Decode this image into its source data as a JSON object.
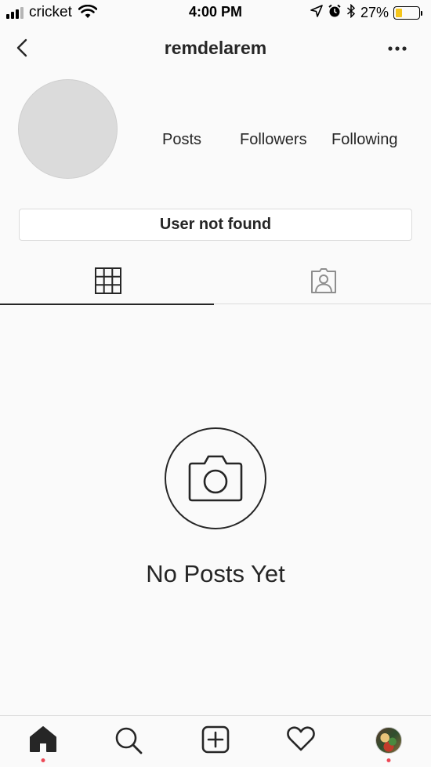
{
  "status_bar": {
    "carrier": "cricket",
    "time": "4:00 PM",
    "battery_percent": "27%",
    "battery_level": 0.27,
    "icons": [
      "signal-icon",
      "wifi-icon",
      "location-icon",
      "alarm-icon",
      "bluetooth-icon",
      "battery-icon"
    ]
  },
  "header": {
    "username": "remdelarem",
    "back_icon": "chevron-left-icon",
    "more_icon": "more-options-icon"
  },
  "profile": {
    "stats": {
      "posts_label": "Posts",
      "followers_label": "Followers",
      "following_label": "Following"
    },
    "status_button_label": "User not found"
  },
  "tabs": [
    {
      "name": "grid",
      "icon": "grid-icon",
      "active": true
    },
    {
      "name": "tagged",
      "icon": "tagged-person-icon",
      "active": false
    }
  ],
  "empty_state": {
    "icon": "camera-icon",
    "text": "No Posts Yet"
  },
  "bottom_nav": {
    "items": [
      "home-icon",
      "search-icon",
      "add-post-icon",
      "activity-heart-icon",
      "profile-avatar"
    ],
    "notification_color": "#ed4956"
  },
  "colors": {
    "text": "#262626",
    "background": "#fafafa",
    "border": "#dbdbdb",
    "battery": "#f4c51a"
  }
}
